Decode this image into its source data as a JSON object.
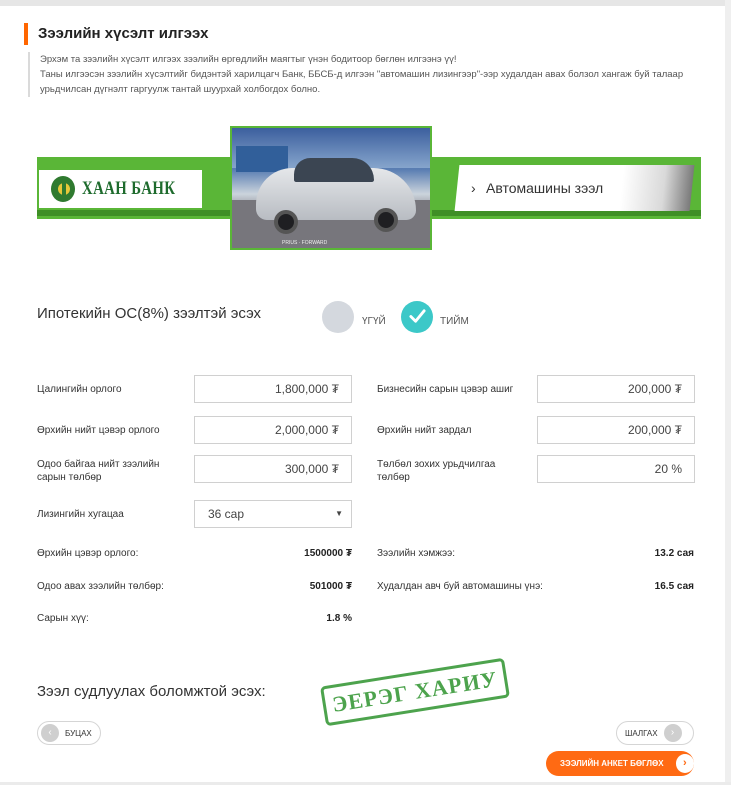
{
  "page": {
    "title": "Зээлийн хүсэлт илгээх",
    "intro": [
      "Эрхэм та зээлийн хүсэлт илгээх зээлийн өргөдлийн маягтыг үнэн бодитоор бөглөн илгээнэ үү!",
      "Таны илгээсэн зээлийн хүсэлтийг бидэнтэй харилцагч Банк, ББСБ-д илгээн \"автомашин лизингээр\"-ээр худалдан авах болзол хангаж буй талаар",
      "урьдчилсан дүгнэлт гаргуулж тантай шуурхай холбогдох болно."
    ]
  },
  "banner": {
    "bank_name": "ХААН БАНК",
    "loan_type": "Автомашины зээл",
    "photo_caption": "PRIUS · FORWARD"
  },
  "mortgage_question": {
    "label": "Ипотекийн ОС(8%) зээлтэй эсэх",
    "option_no": "ҮГҮЙ",
    "option_yes": "ТИЙМ",
    "selected": "yes"
  },
  "form": {
    "salary_income": {
      "label": "Цалингийн орлого",
      "value": "1,800,000 ₮"
    },
    "business_profit": {
      "label": "Бизнесийн сарын цэвэр ашиг",
      "value": "200,000 ₮"
    },
    "household_income": {
      "label": "Өрхийн нийт цэвэр орлого",
      "value": "2,000,000 ₮"
    },
    "household_expense": {
      "label": "Өрхийн нийт зардал",
      "value": "200,000 ₮"
    },
    "current_payment": {
      "label": "Одоо байгаа нийт зээлийн сарын төлбөр",
      "value": "300,000 ₮"
    },
    "down_payment": {
      "label": "Төлбөл зохих урьдчилгаа төлбөр",
      "value": "20 %"
    },
    "lease_term": {
      "label": "Лизингийн хугацаа",
      "value": "36 сар"
    }
  },
  "results": {
    "net_income": {
      "label": "Өрхийн цэвэр орлого:",
      "value": "1500000 ₮"
    },
    "loan_amount": {
      "label": "Зээлийн хэмжээ:",
      "value": "13.2 сая"
    },
    "new_payment": {
      "label": "Одоо авах зээлийн төлбөр:",
      "value": "501000 ₮"
    },
    "car_price": {
      "label": "Худалдан авч буй автомашины үнэ:",
      "value": "16.5 сая"
    },
    "monthly_rate": {
      "label": "Сарын хүү:",
      "value": "1.8 %"
    }
  },
  "research": {
    "label": "Зээл судлуулах боломжтой эсэх:",
    "stamp": "ЭЕРЭГ ХАРИУ"
  },
  "buttons": {
    "back": "БУЦАХ",
    "check": "ШАЛГАХ",
    "submit": "ЗЭЭЛИЙН АНКЕТ БӨГЛӨХ"
  },
  "colors": {
    "accent": "#ff6600",
    "brand_green": "#5ab637",
    "radio_selected": "#3cc8c8",
    "radio_unselected": "#d4d8de",
    "stamp": "#3a9a3a"
  }
}
